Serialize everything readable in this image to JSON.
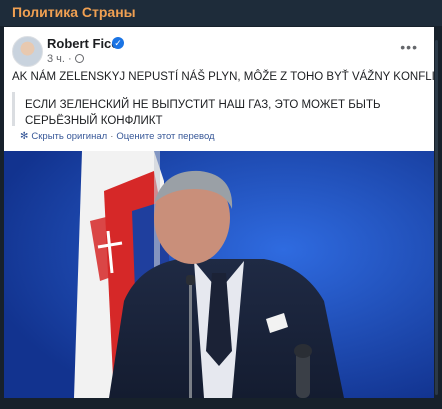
{
  "channel": {
    "title": "Политика Страны"
  },
  "post": {
    "author": "Robert Fico",
    "time": "3 ч.",
    "text": "AK NÁM ZELENSKYJ NEPUSTÍ NÁŠ PLYN, MÔŽE Z TOHO BYŤ VÁŽNY KONFLIKT",
    "translation": "ЕСЛИ ЗЕЛЕНСКИЙ НЕ ВЫПУСТИТ НАШ ГАЗ, ЭТО МОЖЕТ БЫТЬ СЕРЬЁЗНЫЙ КОНФЛИКТ",
    "hide_original": "Скрыть оригинал",
    "rate_translation": "Оцените этот перевод"
  },
  "colors": {
    "channel_title": "#f0a052",
    "background": "#17212b",
    "link": "#385898",
    "verified": "#1b74e4",
    "photo_background": "#1740a6"
  },
  "icons": {
    "verified": "verified-badge-icon",
    "privacy": "globe-icon",
    "menu": "more-horizontal-icon",
    "translate": "gear-icon"
  }
}
